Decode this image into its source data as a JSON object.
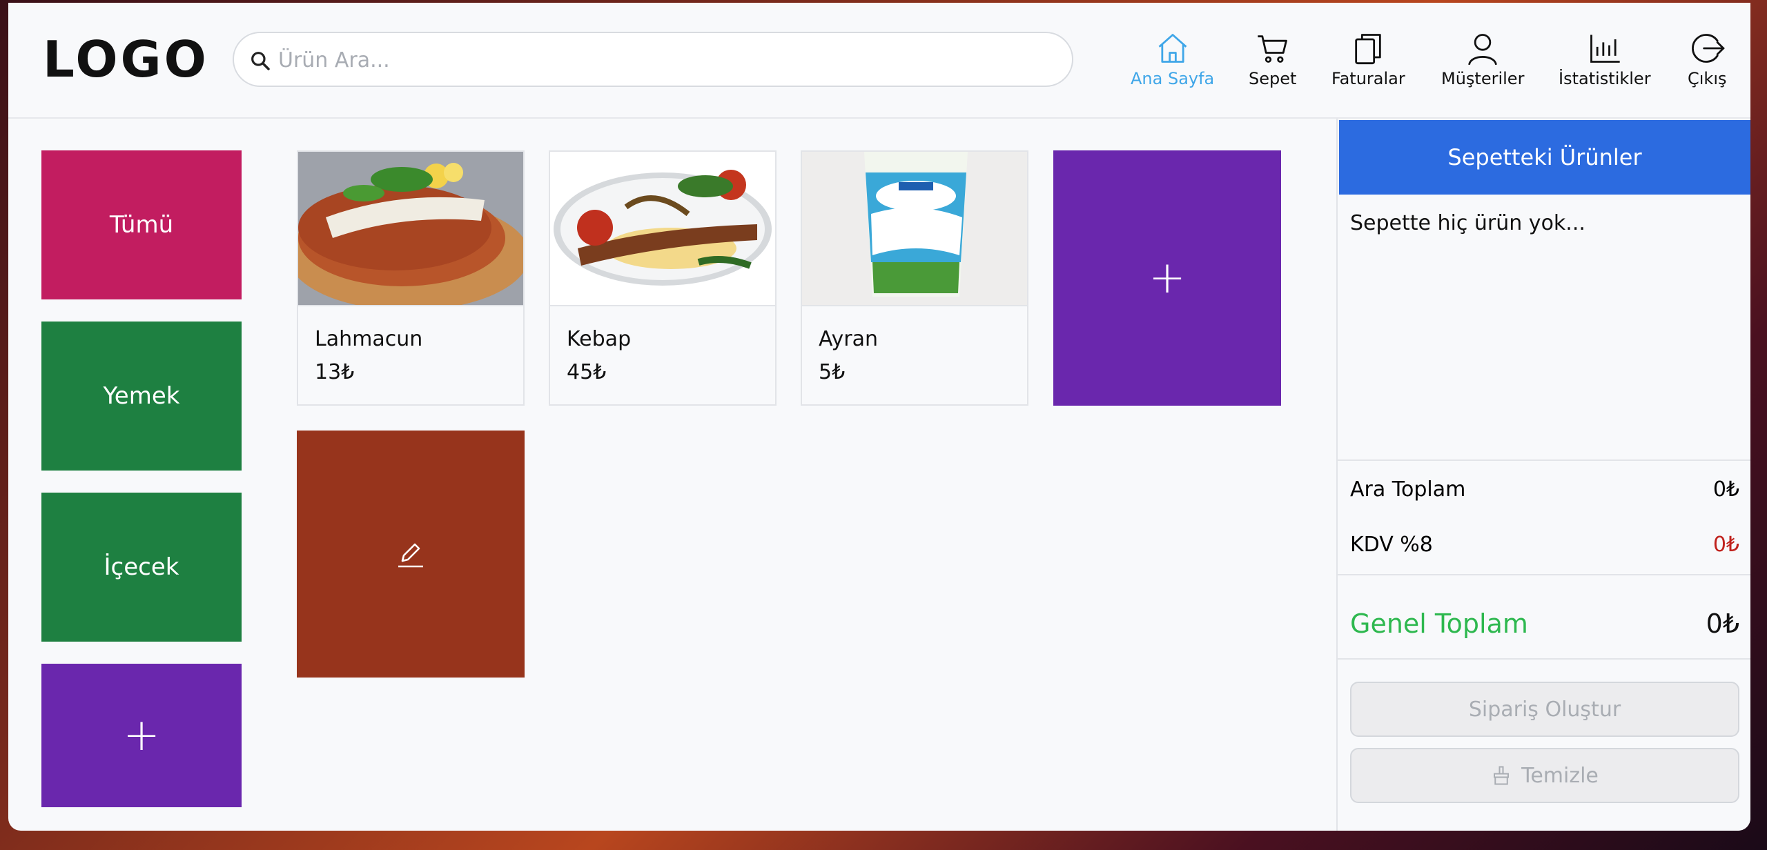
{
  "logo": "LOGO",
  "search": {
    "placeholder": "Ürün Ara..."
  },
  "nav": [
    {
      "label": "Ana Sayfa",
      "icon": "home-icon",
      "active": true
    },
    {
      "label": "Sepet",
      "icon": "cart-icon"
    },
    {
      "label": "Faturalar",
      "icon": "invoices-icon"
    },
    {
      "label": "Müşteriler",
      "icon": "user-icon"
    },
    {
      "label": "İstatistikler",
      "icon": "bar-chart-icon"
    },
    {
      "label": "Çıkış",
      "icon": "logout-icon"
    }
  ],
  "categories": [
    {
      "label": "Tümü",
      "color": "#c21d60"
    },
    {
      "label": "Yemek",
      "color": "#1e8041"
    },
    {
      "label": "İçecek",
      "color": "#1e8041"
    },
    {
      "label": "+",
      "color": "#6a27ad"
    }
  ],
  "products": [
    {
      "name": "Lahmacun",
      "price": "13₺"
    },
    {
      "name": "Kebap",
      "price": "45₺"
    },
    {
      "name": "Ayran",
      "price": "5₺"
    }
  ],
  "add_product": {
    "label": "+",
    "color": "#6a27ad"
  },
  "edit_tile": {
    "color": "#97341c",
    "icon": "pencil-icon"
  },
  "cart": {
    "title": "Sepetteki Ürünler",
    "empty_text": "Sepette hiç ürün yok...",
    "subtotal_label": "Ara Toplam",
    "subtotal_value": "0₺",
    "tax_label": "KDV %8",
    "tax_value": "0₺",
    "total_label": "Genel Toplam",
    "total_value": "0₺",
    "create_order_label": "Sipariş Oluştur",
    "clear_label": "Temizle"
  },
  "colors": {
    "accent_blue": "#2c6be0",
    "nav_active": "#3fa6e8",
    "total_green": "#2eb84f",
    "tax_red": "#c0221d"
  }
}
